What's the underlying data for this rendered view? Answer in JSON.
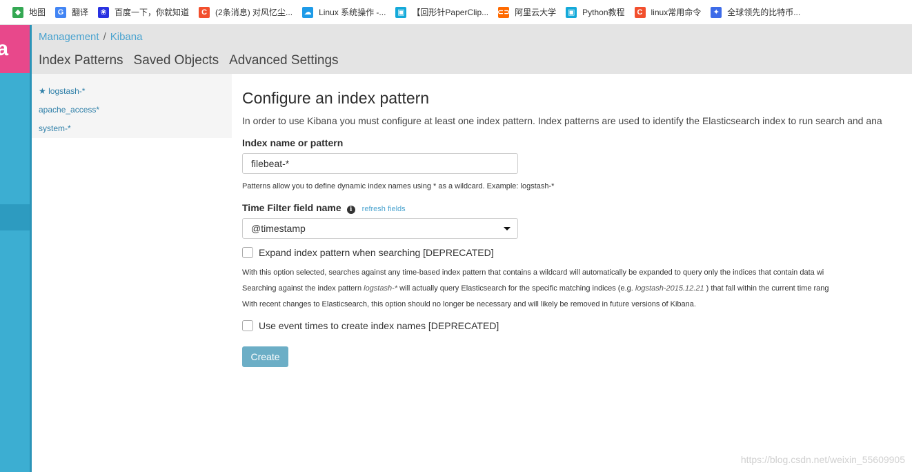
{
  "bookmarks": [
    {
      "label": "地图",
      "icon": "maps-icon",
      "color": "#34a853",
      "glyph": "◆"
    },
    {
      "label": "翻译",
      "icon": "translate-icon",
      "color": "#4285f4",
      "glyph": "G"
    },
    {
      "label": "百度一下，你就知道",
      "icon": "baidu-icon",
      "color": "#2932e1",
      "glyph": "❀"
    },
    {
      "label": "(2条消息) 对风忆尘...",
      "icon": "csdn-icon",
      "color": "#f24f2d",
      "glyph": "C"
    },
    {
      "label": "Linux 系统操作 -...",
      "icon": "cloud-icon",
      "color": "#1e9be8",
      "glyph": "☁"
    },
    {
      "label": "【回形针PaperClip...",
      "icon": "bilibili-icon",
      "color": "#14a9d9",
      "glyph": "▣"
    },
    {
      "label": "阿里云大学",
      "icon": "aliyun-icon",
      "color": "#ff6a00",
      "glyph": "⊂⊃"
    },
    {
      "label": "Python教程",
      "icon": "bilibili-icon",
      "color": "#14a9d9",
      "glyph": "▣"
    },
    {
      "label": "linux常用命令",
      "icon": "csdn-icon",
      "color": "#f24f2d",
      "glyph": "C"
    },
    {
      "label": "全球领先的比特币...",
      "icon": "gem-icon",
      "color": "#3d6be8",
      "glyph": "✦"
    }
  ],
  "sidebar": {
    "logo_text": "a"
  },
  "breadcrumb": {
    "root": "Management",
    "sep": "/",
    "current": "Kibana"
  },
  "tabs": [
    "Index Patterns",
    "Saved Objects",
    "Advanced Settings"
  ],
  "index_list": [
    "logstash-*",
    "apache_access*",
    "system-*"
  ],
  "form": {
    "title": "Configure an index pattern",
    "intro": "In order to use Kibana you must configure at least one index pattern. Index patterns are used to identify the Elasticsearch index to run search and ana",
    "index_label": "Index name or pattern",
    "index_value": "filebeat-*",
    "index_help": "Patterns allow you to define dynamic index names using * as a wildcard. Example: logstash-*",
    "time_label": "Time Filter field name",
    "refresh_label": "refresh fields",
    "time_value": "@timestamp",
    "expand_label": "Expand index pattern when searching [DEPRECATED]",
    "desc1": "With this option selected, searches against any time-based index pattern that contains a wildcard will automatically be expanded to query only the indices that contain data wi",
    "desc2_a": "Searching against the index pattern ",
    "desc2_b": "logstash-*",
    "desc2_c": " will actually query Elasticsearch for the specific matching indices (e.g. ",
    "desc2_d": "logstash-2015.12.21",
    "desc2_e": " ) that fall within the current time rang",
    "desc3": "With recent changes to Elasticsearch, this option should no longer be necessary and will likely be removed in future versions of Kibana.",
    "event_label": "Use event times to create index names [DEPRECATED]",
    "create_label": "Create"
  },
  "watermark": "https://blog.csdn.net/weixin_55609905"
}
